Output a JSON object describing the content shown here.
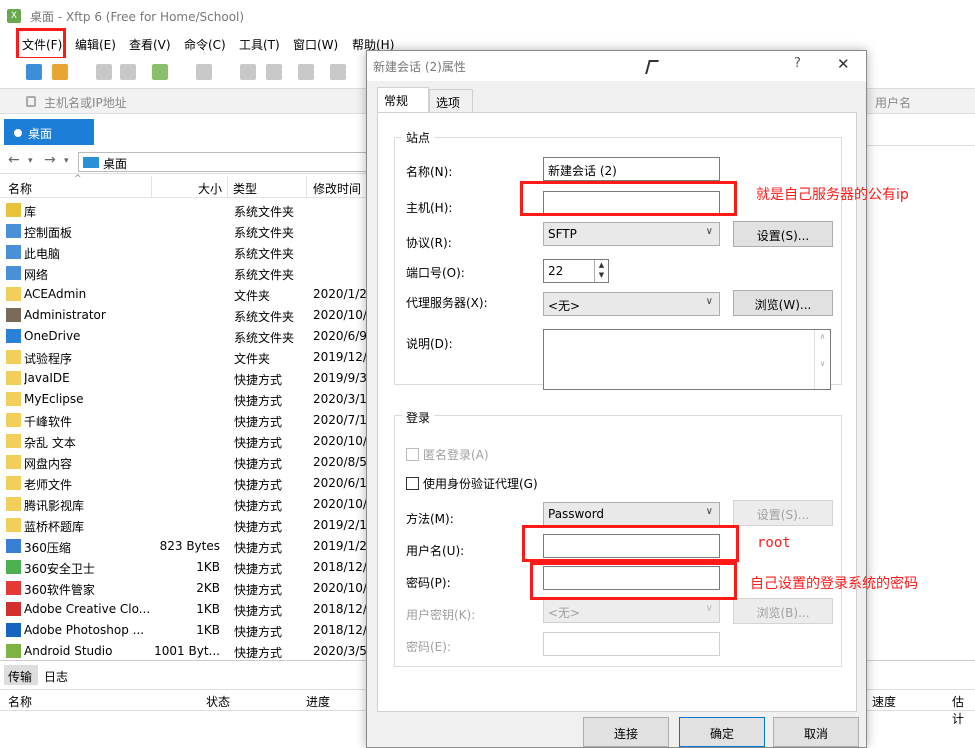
{
  "window": {
    "title": "桌面 - Xftp 6 (Free for Home/School)"
  },
  "menu": [
    "文件(F)",
    "编辑(E)",
    "查看(V)",
    "命令(C)",
    "工具(T)",
    "窗口(W)",
    "帮助(H)"
  ],
  "address": {
    "placeholder": "主机名或IP地址",
    "user_placeholder": "用户名"
  },
  "tab": {
    "label": "桌面"
  },
  "path": {
    "text": "桌面"
  },
  "columns": {
    "name": "名称",
    "size": "大小",
    "type": "类型",
    "modified": "修改时间"
  },
  "files": [
    {
      "name": "库",
      "size": "",
      "type": "系统文件夹",
      "date": ""
    },
    {
      "name": "控制面板",
      "size": "",
      "type": "系统文件夹",
      "date": ""
    },
    {
      "name": "此电脑",
      "size": "",
      "type": "系统文件夹",
      "date": ""
    },
    {
      "name": "网络",
      "size": "",
      "type": "系统文件夹",
      "date": ""
    },
    {
      "name": "ACEAdmin",
      "size": "",
      "type": "文件夹",
      "date": "2020/1/2,"
    },
    {
      "name": "Administrator",
      "size": "",
      "type": "系统文件夹",
      "date": "2020/10/1"
    },
    {
      "name": "OneDrive",
      "size": "",
      "type": "系统文件夹",
      "date": "2020/6/9,"
    },
    {
      "name": "试验程序",
      "size": "",
      "type": "文件夹",
      "date": "2019/12/1"
    },
    {
      "name": "JavaIDE",
      "size": "",
      "type": "快捷方式",
      "date": "2019/9/3,"
    },
    {
      "name": "MyEclipse",
      "size": "",
      "type": "快捷方式",
      "date": "2020/3/11"
    },
    {
      "name": "千峰软件",
      "size": "",
      "type": "快捷方式",
      "date": "2020/7/13"
    },
    {
      "name": "杂乱 文本",
      "size": "",
      "type": "快捷方式",
      "date": "2020/10/2"
    },
    {
      "name": "网盘内容",
      "size": "",
      "type": "快捷方式",
      "date": "2020/8/5,"
    },
    {
      "name": "老师文件",
      "size": "",
      "type": "快捷方式",
      "date": "2020/6/10"
    },
    {
      "name": "腾讯影视库",
      "size": "",
      "type": "快捷方式",
      "date": "2020/10/5"
    },
    {
      "name": "蓝桥杯题库",
      "size": "",
      "type": "快捷方式",
      "date": "2019/2/18"
    },
    {
      "name": "360压缩",
      "size": "823 Bytes",
      "type": "快捷方式",
      "date": "2019/1/2,"
    },
    {
      "name": "360安全卫士",
      "size": "1KB",
      "type": "快捷方式",
      "date": "2018/12/1"
    },
    {
      "name": "360软件管家",
      "size": "2KB",
      "type": "快捷方式",
      "date": "2020/10/2"
    },
    {
      "name": "Adobe Creative Clo...",
      "size": "1KB",
      "type": "快捷方式",
      "date": "2018/12/1"
    },
    {
      "name": "Adobe Photoshop ...",
      "size": "1KB",
      "type": "快捷方式",
      "date": "2018/12/2"
    },
    {
      "name": "Android Studio",
      "size": "1001 Byt...",
      "type": "快捷方式",
      "date": "2020/3/5,"
    }
  ],
  "bottom": {
    "tab_transfer": "传输",
    "tab_log": "日志",
    "col_name": "名称",
    "col_status": "状态",
    "col_progress": "进度",
    "col_speed": "速度",
    "col_estimate": "估计"
  },
  "dialog": {
    "title": "新建会话 (2)属性",
    "help": "?",
    "tab_general": "常规",
    "tab_options": "选项",
    "site_group": "站点",
    "name_label": "名称(N):",
    "name_value": "新建会话 (2)",
    "host_label": "主机(H):",
    "host_value": "",
    "protocol_label": "协议(R):",
    "protocol_value": "SFTP",
    "settings_button": "设置(S)...",
    "port_label": "端口号(O):",
    "port_value": "22",
    "proxy_label": "代理服务器(X):",
    "proxy_value": "<无>",
    "browse_button": "浏览(W)...",
    "desc_label": "说明(D):",
    "login_group": "登录",
    "anonymous_label": "匿名登录(A)",
    "agent_label": "使用身份验证代理(G)",
    "method_label": "方法(M):",
    "method_value": "Password",
    "method_settings_button": "设置(S)...",
    "user_label": "用户名(U):",
    "pass_label": "密码(P):",
    "userkey_label": "用户密钥(K):",
    "userkey_value": "<无>",
    "userkey_browse": "浏览(B)...",
    "passphrase_label": "密码(E):",
    "connect_button": "连接",
    "ok_button": "确定",
    "cancel_button": "取消"
  },
  "annotations": {
    "host_note": "就是自己服务器的公有ip",
    "user_note": "root",
    "pass_note": "自己设置的登录系统的密码",
    "accent": "#ff1a1a"
  }
}
